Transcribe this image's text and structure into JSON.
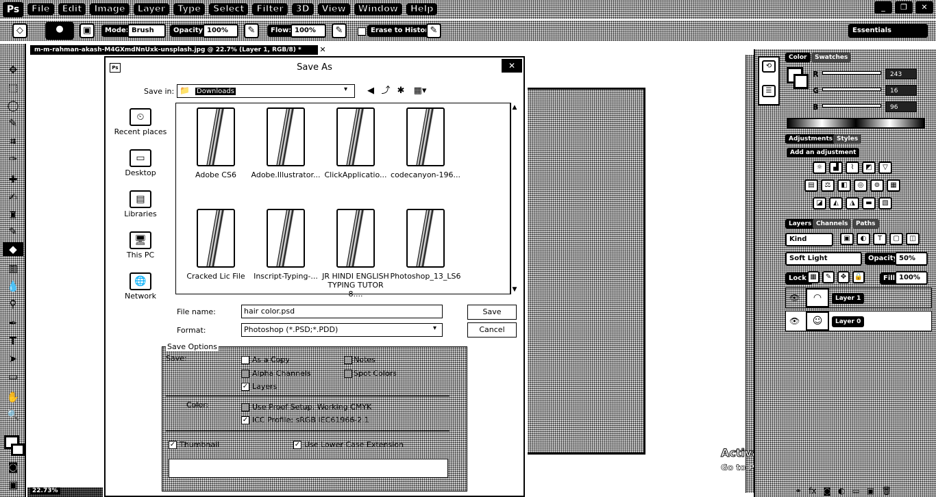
{
  "app": {
    "logo": "Ps",
    "menu": [
      "File",
      "Edit",
      "Image",
      "Layer",
      "Type",
      "Select",
      "Filter",
      "3D",
      "View",
      "Window",
      "Help"
    ],
    "window_buttons": [
      "_",
      "❐",
      "✕"
    ]
  },
  "options_bar": {
    "mode_label": "Mode:",
    "mode_value": "Brush",
    "opacity_label": "Opacity:",
    "opacity_value": "100%",
    "flow_label": "Flow:",
    "flow_value": "100%",
    "erase_history": "Erase to History",
    "workspace": "Essentials"
  },
  "document": {
    "tab_title": "m-m-rahman-akash-M4GXmdNnUxk-unsplash.jpg @ 22.7% (Layer 1, RGB/8) *",
    "zoom": "22.73%"
  },
  "watermark": {
    "line1": "Activate Windows",
    "line2": "Go to PC settings to activate Windows."
  },
  "panels": {
    "color_tab": "Color",
    "swatches_tab": "Swatches",
    "r_label": "R",
    "g_label": "G",
    "b_label": "B",
    "r_value": "243",
    "g_value": "16",
    "b_value": "96",
    "adjustments_tab": "Adjustments",
    "styles_tab": "Styles",
    "add_adjustment": "Add an adjustment",
    "layers_tab": "Layers",
    "channels_tab": "Channels",
    "paths_tab": "Paths",
    "kind": "Kind",
    "blend_mode": "Soft Light",
    "opacity_label": "Opacity:",
    "opacity_value": "50%",
    "lock_label": "Lock:",
    "fill_label": "Fill:",
    "fill_value": "100%",
    "layers": [
      {
        "name": "Layer 1"
      },
      {
        "name": "Layer 0"
      }
    ]
  },
  "dialog": {
    "title": "Save As",
    "save_in_label": "Save in:",
    "save_in_value": "Downloads",
    "places": [
      "Recent places",
      "Desktop",
      "Libraries",
      "This PC",
      "Network"
    ],
    "files": [
      {
        "name": "Adobe CS6"
      },
      {
        "name": "Adobe.Illustrator..."
      },
      {
        "name": "ClickApplicatio..."
      },
      {
        "name": "codecanyon-196..."
      },
      {
        "name": "Cracked Lic File"
      },
      {
        "name": "Inscript-Typing-..."
      },
      {
        "name": "JR HINDI ENGLISH TYPING TUTOR 8...."
      },
      {
        "name": "Photoshop_13_LS6"
      }
    ],
    "file_name_label": "File name:",
    "file_name_value": "hair color.psd",
    "format_label": "Format:",
    "format_value": "Photoshop (*.PSD;*.PDD)",
    "save_button": "Save",
    "cancel_button": "Cancel",
    "save_options_legend": "Save Options",
    "save_label": "Save:",
    "as_a_copy": "As a Copy",
    "notes": "Notes",
    "alpha_channels": "Alpha Channels",
    "spot_colors": "Spot Colors",
    "layers": "Layers",
    "color_label": "Color:",
    "use_proof_setup": "Use Proof Setup:  Working CMYK",
    "icc_profile": "ICC Profile:  sRGB IEC61966-2.1",
    "thumbnail": "Thumbnail",
    "lower_case": "Use Lower Case Extension"
  }
}
